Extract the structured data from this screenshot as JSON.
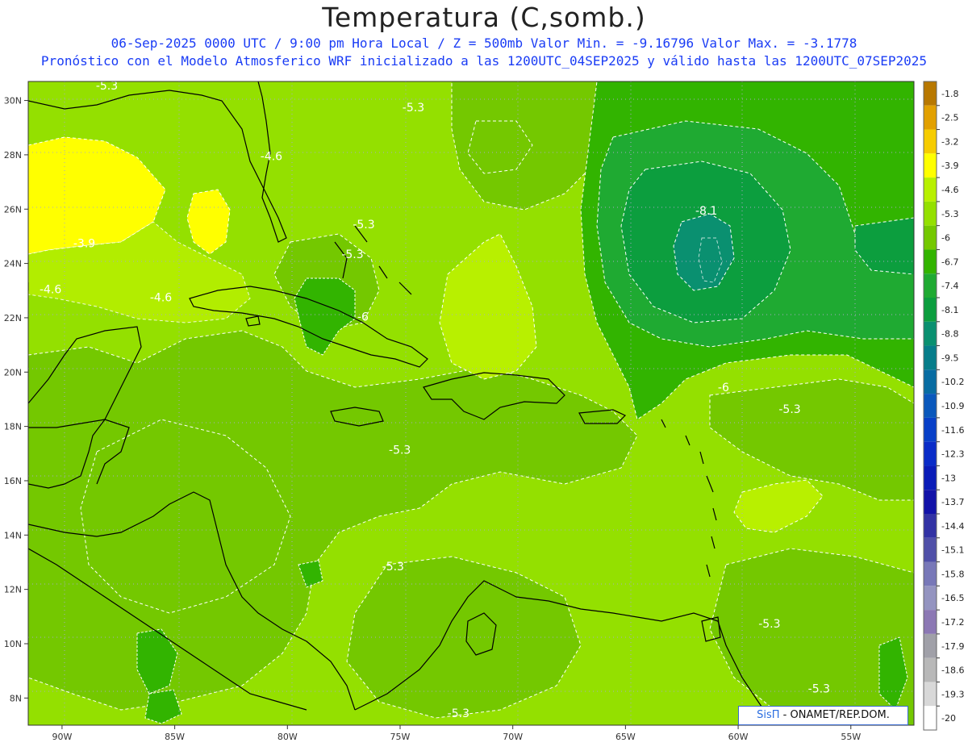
{
  "title": "Temperatura (C,somb.)",
  "subtitle_line1": "06-Sep-2025  0000 UTC / 9:00 pm Hora Local / Z = 500mb   Valor Min. = -9.16796  Valor Max. = -3.1778",
  "subtitle_line2": "Pronóstico con el Modelo Atmosferico WRF inicializado a las 1200UTC_04SEP2025 y válido hasta las  1200UTC_07SEP2025",
  "credit": {
    "brand": "SisΠ",
    "text": " - ONAMET/REP.DOM."
  },
  "map": {
    "lat_labels": [
      "30N",
      "28N",
      "26N",
      "24N",
      "22N",
      "20N",
      "18N",
      "16N",
      "14N",
      "12N",
      "10N",
      "8N"
    ],
    "lon_labels": [
      "90W",
      "85W",
      "80W",
      "75W",
      "70W",
      "65W",
      "60W",
      "55W"
    ],
    "lat_range": [
      7,
      30.7
    ],
    "lon_range": [
      -91.5,
      -52.2
    ],
    "contour_labels": [
      {
        "text": "-5.3",
        "lon": -88.5,
        "lat": 30.4
      },
      {
        "text": "-5.3",
        "lon": -74.9,
        "lat": 29.6
      },
      {
        "text": "-4.6",
        "lon": -81.2,
        "lat": 27.8
      },
      {
        "text": "-5.3",
        "lon": -77.1,
        "lat": 25.3
      },
      {
        "text": "-3.9",
        "lon": -89.5,
        "lat": 24.6
      },
      {
        "text": "-5.3",
        "lon": -77.6,
        "lat": 24.2
      },
      {
        "text": "-4.6",
        "lon": -91.0,
        "lat": 22.9
      },
      {
        "text": "-4.6",
        "lon": -86.1,
        "lat": 22.6
      },
      {
        "text": "-6",
        "lon": -76.9,
        "lat": 21.9
      },
      {
        "text": "-8.1",
        "lon": -61.9,
        "lat": 25.8
      },
      {
        "text": "-6",
        "lon": -60.9,
        "lat": 19.3
      },
      {
        "text": "-5.3",
        "lon": -58.2,
        "lat": 18.5
      },
      {
        "text": "-5.3",
        "lon": -75.5,
        "lat": 17.0
      },
      {
        "text": "-5.3",
        "lon": -75.8,
        "lat": 12.7
      },
      {
        "text": "-5.3",
        "lon": -59.1,
        "lat": 10.6
      },
      {
        "text": "-5.3",
        "lon": -56.9,
        "lat": 8.2
      },
      {
        "text": "-5.3",
        "lon": -72.9,
        "lat": 7.3
      }
    ]
  },
  "colorbar": {
    "colors": [
      "#b87800",
      "#e2a000",
      "#f6cc00",
      "#ffff00",
      "#b8f000",
      "#94e000",
      "#74c800",
      "#32b400",
      "#1faa32",
      "#0c9e3e",
      "#0a9070",
      "#077d8a",
      "#086ca2",
      "#0a58bc",
      "#0840c8",
      "#0a2cc8",
      "#0a1cb8",
      "#1212a8",
      "#3232a4",
      "#5050a8",
      "#7878b8",
      "#9494c0",
      "#8c78b4",
      "#a0a0a8",
      "#b8b8b8",
      "#d8d8d8",
      "#ffffff"
    ],
    "labels": [
      "-1.8",
      "-2.5",
      "-3.2",
      "-3.9",
      "-4.6",
      "-5.3",
      "-6",
      "-6.7",
      "-7.4",
      "-8.1",
      "-8.8",
      "-9.5",
      "-10.2",
      "-10.9",
      "-11.6",
      "-12.3",
      "-13",
      "-13.7",
      "-14.4",
      "-15.1",
      "-15.8",
      "-16.5",
      "-17.2",
      "-17.9",
      "-18.6",
      "-19.3",
      "-20"
    ]
  }
}
